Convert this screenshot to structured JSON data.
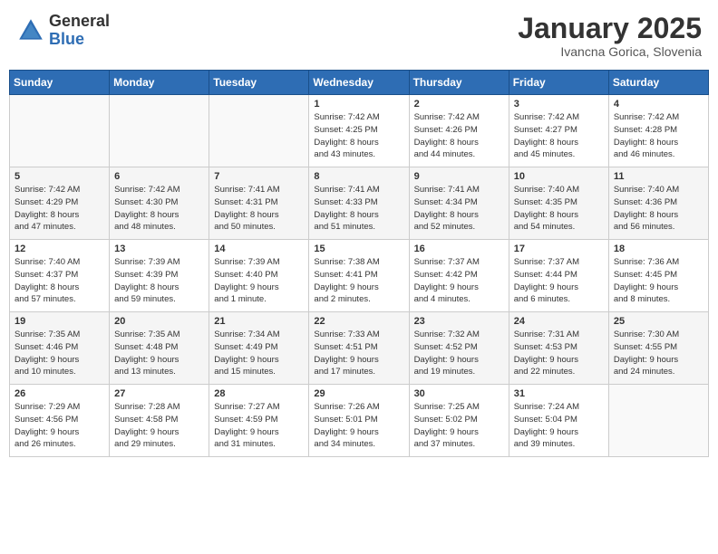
{
  "header": {
    "logo_general": "General",
    "logo_blue": "Blue",
    "month": "January 2025",
    "location": "Ivancna Gorica, Slovenia"
  },
  "weekdays": [
    "Sunday",
    "Monday",
    "Tuesday",
    "Wednesday",
    "Thursday",
    "Friday",
    "Saturday"
  ],
  "weeks": [
    [
      {
        "day": "",
        "info": ""
      },
      {
        "day": "",
        "info": ""
      },
      {
        "day": "",
        "info": ""
      },
      {
        "day": "1",
        "info": "Sunrise: 7:42 AM\nSunset: 4:25 PM\nDaylight: 8 hours\nand 43 minutes."
      },
      {
        "day": "2",
        "info": "Sunrise: 7:42 AM\nSunset: 4:26 PM\nDaylight: 8 hours\nand 44 minutes."
      },
      {
        "day": "3",
        "info": "Sunrise: 7:42 AM\nSunset: 4:27 PM\nDaylight: 8 hours\nand 45 minutes."
      },
      {
        "day": "4",
        "info": "Sunrise: 7:42 AM\nSunset: 4:28 PM\nDaylight: 8 hours\nand 46 minutes."
      }
    ],
    [
      {
        "day": "5",
        "info": "Sunrise: 7:42 AM\nSunset: 4:29 PM\nDaylight: 8 hours\nand 47 minutes."
      },
      {
        "day": "6",
        "info": "Sunrise: 7:42 AM\nSunset: 4:30 PM\nDaylight: 8 hours\nand 48 minutes."
      },
      {
        "day": "7",
        "info": "Sunrise: 7:41 AM\nSunset: 4:31 PM\nDaylight: 8 hours\nand 50 minutes."
      },
      {
        "day": "8",
        "info": "Sunrise: 7:41 AM\nSunset: 4:33 PM\nDaylight: 8 hours\nand 51 minutes."
      },
      {
        "day": "9",
        "info": "Sunrise: 7:41 AM\nSunset: 4:34 PM\nDaylight: 8 hours\nand 52 minutes."
      },
      {
        "day": "10",
        "info": "Sunrise: 7:40 AM\nSunset: 4:35 PM\nDaylight: 8 hours\nand 54 minutes."
      },
      {
        "day": "11",
        "info": "Sunrise: 7:40 AM\nSunset: 4:36 PM\nDaylight: 8 hours\nand 56 minutes."
      }
    ],
    [
      {
        "day": "12",
        "info": "Sunrise: 7:40 AM\nSunset: 4:37 PM\nDaylight: 8 hours\nand 57 minutes."
      },
      {
        "day": "13",
        "info": "Sunrise: 7:39 AM\nSunset: 4:39 PM\nDaylight: 8 hours\nand 59 minutes."
      },
      {
        "day": "14",
        "info": "Sunrise: 7:39 AM\nSunset: 4:40 PM\nDaylight: 9 hours\nand 1 minute."
      },
      {
        "day": "15",
        "info": "Sunrise: 7:38 AM\nSunset: 4:41 PM\nDaylight: 9 hours\nand 2 minutes."
      },
      {
        "day": "16",
        "info": "Sunrise: 7:37 AM\nSunset: 4:42 PM\nDaylight: 9 hours\nand 4 minutes."
      },
      {
        "day": "17",
        "info": "Sunrise: 7:37 AM\nSunset: 4:44 PM\nDaylight: 9 hours\nand 6 minutes."
      },
      {
        "day": "18",
        "info": "Sunrise: 7:36 AM\nSunset: 4:45 PM\nDaylight: 9 hours\nand 8 minutes."
      }
    ],
    [
      {
        "day": "19",
        "info": "Sunrise: 7:35 AM\nSunset: 4:46 PM\nDaylight: 9 hours\nand 10 minutes."
      },
      {
        "day": "20",
        "info": "Sunrise: 7:35 AM\nSunset: 4:48 PM\nDaylight: 9 hours\nand 13 minutes."
      },
      {
        "day": "21",
        "info": "Sunrise: 7:34 AM\nSunset: 4:49 PM\nDaylight: 9 hours\nand 15 minutes."
      },
      {
        "day": "22",
        "info": "Sunrise: 7:33 AM\nSunset: 4:51 PM\nDaylight: 9 hours\nand 17 minutes."
      },
      {
        "day": "23",
        "info": "Sunrise: 7:32 AM\nSunset: 4:52 PM\nDaylight: 9 hours\nand 19 minutes."
      },
      {
        "day": "24",
        "info": "Sunrise: 7:31 AM\nSunset: 4:53 PM\nDaylight: 9 hours\nand 22 minutes."
      },
      {
        "day": "25",
        "info": "Sunrise: 7:30 AM\nSunset: 4:55 PM\nDaylight: 9 hours\nand 24 minutes."
      }
    ],
    [
      {
        "day": "26",
        "info": "Sunrise: 7:29 AM\nSunset: 4:56 PM\nDaylight: 9 hours\nand 26 minutes."
      },
      {
        "day": "27",
        "info": "Sunrise: 7:28 AM\nSunset: 4:58 PM\nDaylight: 9 hours\nand 29 minutes."
      },
      {
        "day": "28",
        "info": "Sunrise: 7:27 AM\nSunset: 4:59 PM\nDaylight: 9 hours\nand 31 minutes."
      },
      {
        "day": "29",
        "info": "Sunrise: 7:26 AM\nSunset: 5:01 PM\nDaylight: 9 hours\nand 34 minutes."
      },
      {
        "day": "30",
        "info": "Sunrise: 7:25 AM\nSunset: 5:02 PM\nDaylight: 9 hours\nand 37 minutes."
      },
      {
        "day": "31",
        "info": "Sunrise: 7:24 AM\nSunset: 5:04 PM\nDaylight: 9 hours\nand 39 minutes."
      },
      {
        "day": "",
        "info": ""
      }
    ]
  ]
}
